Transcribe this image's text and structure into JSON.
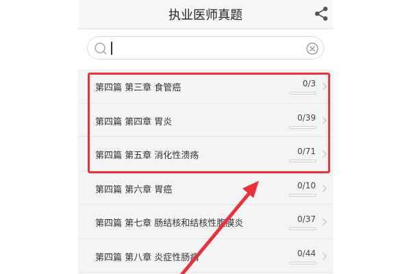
{
  "header": {
    "title": "执业医师真题",
    "share_icon": "share-icon"
  },
  "search": {
    "value": "",
    "placeholder": "",
    "search_icon": "search-icon",
    "clear_icon": "clear-circle-icon"
  },
  "items": [
    {
      "label": "第四篇 第三章 食管癌",
      "count": "0/3",
      "progress": 0
    },
    {
      "label": "第四篇 第四章 胃炎",
      "count": "0/39",
      "progress": 0
    },
    {
      "label": "第四篇 第五章 消化性溃疡",
      "count": "0/71",
      "progress": 0
    },
    {
      "label": "第四篇 第六章 胃癌",
      "count": "0/10",
      "progress": 0
    },
    {
      "label": "第四篇 第七章 肠结核和结核性腹膜炎",
      "count": "0/37",
      "progress": 0
    },
    {
      "label": "第四篇 第八章 炎症性肠病",
      "count": "0/44",
      "progress": 0
    }
  ],
  "annotation": {
    "highlight_color": "#e8313a",
    "arrow_color": "#e8313a"
  },
  "colors": {
    "progress_fill": "#3aa0e8"
  }
}
